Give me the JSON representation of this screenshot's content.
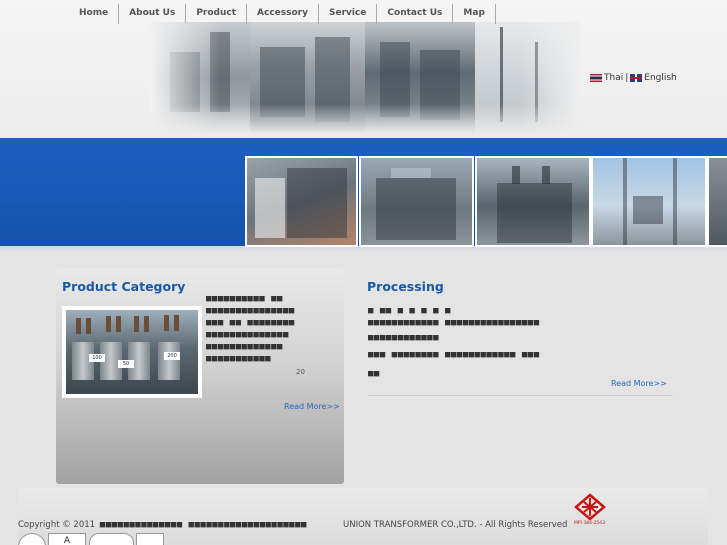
{
  "nav": [
    "Home",
    "About Us",
    "Product",
    "Accessory",
    "Service",
    "Contact Us",
    "Map"
  ],
  "lang": {
    "thai": "Thai",
    "sep": "|",
    "english": "English"
  },
  "product_category": {
    "title": "Product Category",
    "text_lines": [
      "■■■■■■■■■■   ■■",
      "■■■■■■■■■■■■■■■",
      "■■■ ■■ ■■■■■■■■",
      "■■■■■■■■■■■■■■",
      "■■■■■■■■■■■■■",
      "■■■■■■■■■■■"
    ],
    "number": "20",
    "read_more": "Read More>>"
  },
  "processing": {
    "title": "Processing",
    "text_lines": [
      "■ ■■  ■  ■  ■            ■  ■",
      "■■■■■■■■■■■■ ■■■■■■■■■■■■■■■■",
      "■■■■■■■■■■■■",
      "■■■ ■■■■■■■■ ■■■■■■■■■■■■ ■■■",
      "■■"
    ],
    "read_more": "Read More>>"
  },
  "footer": {
    "copyright": "Copyright © 2011",
    "company_glyphs": "■■■■■■■■■■■■■■ ■■■■■■■■■■■■■■■■■■■■",
    "company": "UNION TRANSFORMER CO.,LTD. - All Rights Reserved",
    "logo_caption": "MPI 384-2543",
    "cert_mark": "A"
  },
  "colors": {
    "nav_text": "#555555",
    "heading": "#1a58a8",
    "band_blue": "#1b60c2",
    "link": "#2a66b8",
    "logo_red": "#cc1111"
  }
}
